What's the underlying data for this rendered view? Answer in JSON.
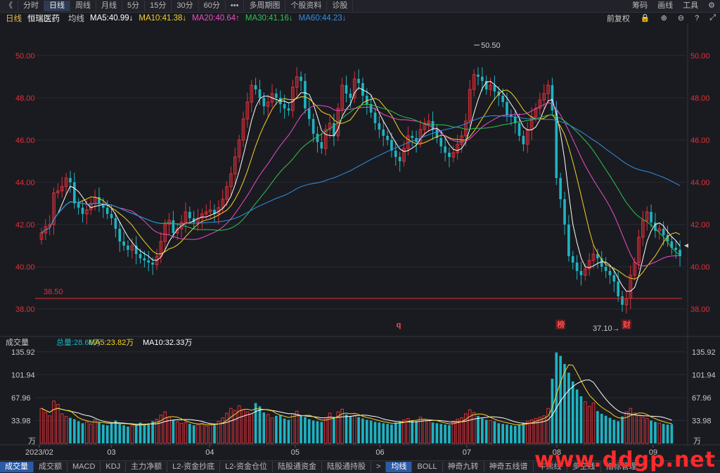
{
  "toolbar": {
    "left_items": [
      "《",
      "分时",
      "日线",
      "周线",
      "月线",
      "5分",
      "15分",
      "30分",
      "60分",
      "•••",
      "多周期图",
      "个股资料",
      "诊股"
    ],
    "active": "日线",
    "right_items": [
      "筹码",
      "画线",
      "工具"
    ]
  },
  "header": {
    "period": "日线",
    "stock": "恒瑞医药",
    "ma_label": "均线",
    "ma5": "MA5:40.99↓",
    "ma10": "MA10:41.38↓",
    "ma20": "MA20:40.64↑",
    "ma30": "MA30:41.16↓",
    "ma60": "MA60:44.23↓",
    "adjust": "前复权"
  },
  "colors": {
    "up": "#e0303a",
    "down": "#1fb3c2",
    "ma5": "#ffffff",
    "ma10": "#f5d327",
    "ma20": "#e94ec8",
    "ma30": "#2ec44f",
    "ma60": "#2f8fe6",
    "bg": "#1a1b20"
  },
  "price_axis": {
    "ticks": [
      "50.00",
      "48.00",
      "46.00",
      "44.00",
      "42.00",
      "40.00",
      "38.00"
    ]
  },
  "annotations": {
    "high": "50.50",
    "low": "37.10",
    "hline": "38.50",
    "markers": [
      "q",
      "榜",
      "财"
    ]
  },
  "volume_panel": {
    "title": "成交量",
    "total": "总量:28.66万",
    "ma5": "MA5:23.82万",
    "ma10": "MA10:32.33万",
    "ticks": [
      "135.92",
      "101.94",
      "67.96",
      "33.98"
    ],
    "unit": "万"
  },
  "x_axis": {
    "labels": [
      "2023/02",
      "03",
      "04",
      "05",
      "06",
      "07",
      "08",
      "09"
    ]
  },
  "bottom_tabs": [
    "成交量",
    "成交额",
    "MACD",
    "KDJ",
    "主力净额",
    "L2-资金抄底",
    "L2-资金仓位",
    "陆股通资金",
    "陆股通持股",
    ">",
    "均线",
    "BOLL",
    "神奇九转",
    "神奇五线谱",
    "牛熊线",
    "多空线",
    "指标管理"
  ],
  "bottom_active": [
    "成交量",
    "均线"
  ],
  "watermark": "www.ddgp.net",
  "chart_data": {
    "type": "candlestick",
    "price_range": [
      37.0,
      51.3
    ],
    "volume_range": [
      0,
      140
    ],
    "closes": [
      41.6,
      41.9,
      42.0,
      43.5,
      43.6,
      43.8,
      44.2,
      44.0,
      43.0,
      42.8,
      42.5,
      42.7,
      43.0,
      43.3,
      43.0,
      42.8,
      42.5,
      42.3,
      41.8,
      41.2,
      41.0,
      40.8,
      41.0,
      40.6,
      40.4,
      40.3,
      40.2,
      40.1,
      40.5,
      41.2,
      42.0,
      42.2,
      41.6,
      41.8,
      42.1,
      42.6,
      42.3,
      42.1,
      42.3,
      42.5,
      42.6,
      42.7,
      42.5,
      42.8,
      43.2,
      43.8,
      44.4,
      45.2,
      46.0,
      47.0,
      47.8,
      48.6,
      48.4,
      48.0,
      47.6,
      47.8,
      48.2,
      48.0,
      47.7,
      47.5,
      47.4,
      48.5,
      49.0,
      48.8,
      47.5,
      47.0,
      46.3,
      45.9,
      45.6,
      46.5,
      46.8,
      46.2,
      47.5,
      48.6,
      48.2,
      48.0,
      48.9,
      48.7,
      48.1,
      47.7,
      47.3,
      46.8,
      46.5,
      46.2,
      46.0,
      45.5,
      45.2,
      45.0,
      45.6,
      46.2,
      46.1,
      45.9,
      46.5,
      46.8,
      46.9,
      46.5,
      46.1,
      45.7,
      45.4,
      45.2,
      45.4,
      45.8,
      46.2,
      46.9,
      48.4,
      49.1,
      49.0,
      48.8,
      48.4,
      48.6,
      48.3,
      48.1,
      47.8,
      47.2,
      47.1,
      46.8,
      46.2,
      45.8,
      46.5,
      47.1,
      47.5,
      47.9,
      48.2,
      48.6,
      47.4,
      44.2,
      43.2,
      42.0,
      40.5,
      40.2,
      39.8,
      39.6,
      39.9,
      40.3,
      40.6,
      40.4,
      40.0,
      39.8,
      39.6,
      39.3,
      38.6,
      38.2,
      38.5,
      39.6,
      40.2,
      41.4,
      42.2,
      42.6,
      42.1,
      41.7,
      41.8,
      41.5,
      41.2,
      40.9,
      40.8,
      40.5
    ],
    "opens": [
      41.3,
      41.6,
      41.9,
      42.0,
      43.5,
      43.6,
      43.8,
      44.2,
      44.0,
      43.0,
      42.8,
      42.5,
      42.7,
      43.0,
      43.3,
      43.0,
      42.8,
      42.5,
      42.3,
      41.8,
      41.2,
      41.0,
      40.8,
      41.0,
      40.6,
      40.4,
      40.3,
      40.2,
      40.1,
      40.5,
      41.2,
      42.0,
      42.2,
      41.6,
      41.8,
      42.1,
      42.6,
      42.3,
      42.1,
      42.3,
      42.5,
      42.6,
      42.7,
      42.5,
      42.8,
      43.2,
      43.8,
      44.4,
      45.2,
      46.0,
      47.0,
      47.8,
      48.6,
      48.4,
      48.0,
      47.6,
      47.8,
      48.2,
      48.0,
      47.7,
      47.5,
      47.4,
      48.5,
      49.0,
      48.8,
      47.5,
      47.0,
      46.3,
      45.9,
      45.6,
      46.5,
      46.8,
      46.2,
      47.5,
      48.6,
      48.2,
      48.0,
      48.9,
      48.7,
      48.1,
      47.7,
      47.3,
      46.8,
      46.5,
      46.2,
      46.0,
      45.5,
      45.2,
      45.0,
      45.6,
      46.2,
      46.1,
      45.9,
      46.5,
      46.8,
      46.9,
      46.5,
      46.1,
      45.7,
      45.4,
      45.2,
      45.4,
      45.8,
      46.2,
      46.9,
      48.4,
      49.1,
      49.0,
      48.8,
      48.4,
      48.6,
      48.3,
      48.1,
      47.8,
      47.2,
      47.1,
      46.8,
      46.2,
      45.8,
      46.5,
      47.1,
      47.5,
      47.9,
      48.2,
      48.6,
      47.4,
      44.2,
      43.2,
      42.0,
      40.5,
      40.2,
      39.8,
      39.6,
      39.9,
      40.3,
      40.6,
      40.4,
      40.0,
      39.8,
      39.6,
      39.3,
      38.6,
      38.2,
      38.5,
      39.6,
      40.2,
      41.4,
      42.2,
      42.6,
      42.1,
      41.7,
      41.8,
      41.5,
      41.2,
      40.9,
      40.8
    ],
    "volumes": [
      52,
      46,
      41,
      63,
      58,
      44,
      40,
      38,
      36,
      33,
      30,
      32,
      29,
      35,
      31,
      28,
      27,
      30,
      34,
      29,
      27,
      25,
      26,
      28,
      31,
      27,
      30,
      33,
      36,
      42,
      47,
      39,
      35,
      32,
      30,
      31,
      29,
      27,
      28,
      30,
      26,
      28,
      27,
      33,
      38,
      45,
      52,
      49,
      56,
      50,
      47,
      44,
      60,
      55,
      46,
      43,
      38,
      41,
      42,
      37,
      35,
      44,
      48,
      42,
      39,
      36,
      34,
      33,
      32,
      38,
      45,
      39,
      47,
      51,
      43,
      40,
      42,
      39,
      37,
      35,
      34,
      32,
      31,
      30,
      29,
      28,
      31,
      33,
      35,
      37,
      34,
      33,
      39,
      36,
      34,
      31,
      30,
      29,
      28,
      27,
      33,
      36,
      38,
      44,
      50,
      46,
      41,
      37,
      35,
      34,
      33,
      30,
      29,
      28,
      27,
      26,
      28,
      31,
      33,
      35,
      37,
      39,
      41,
      52,
      96,
      135,
      130,
      118,
      105,
      92,
      80,
      70,
      62,
      55,
      60,
      48,
      44,
      41,
      38,
      35,
      33,
      40,
      47,
      52,
      45,
      42,
      39,
      37,
      34,
      32,
      30,
      29,
      28,
      28.66
    ],
    "ma_values_last": {
      "ma5": 40.99,
      "ma10": 41.38,
      "ma20": 40.64,
      "ma30": 41.16,
      "ma60": 44.23
    },
    "x_labels": [
      "2023/02",
      "03",
      "04",
      "05",
      "06",
      "07",
      "08",
      "09"
    ]
  }
}
